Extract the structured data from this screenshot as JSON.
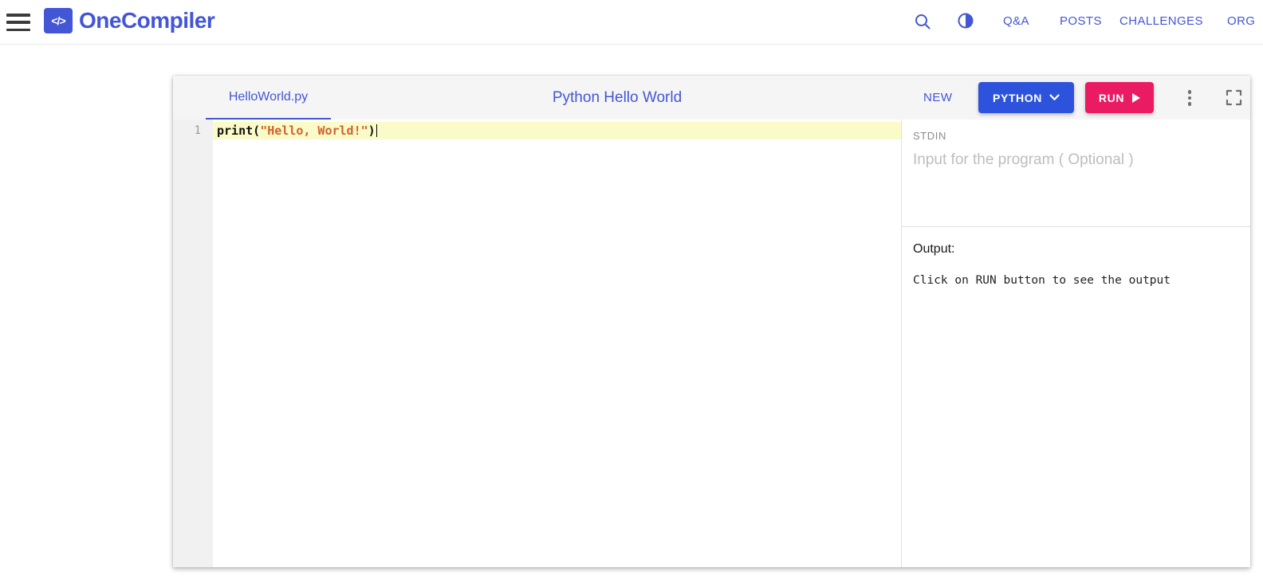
{
  "colors": {
    "brand_blue": "#4356d6",
    "python_button_blue": "#2d53dd",
    "run_button_pink": "#ea1b63",
    "active_line_yellow": "#fbfbc9",
    "code_string_orange": "#d0622b"
  },
  "navbar": {
    "brand": "OneCompiler",
    "brand_icon_glyph": "</>",
    "icons": [
      "search-icon",
      "theme-toggle-icon"
    ],
    "links": [
      {
        "label": "Q&A"
      },
      {
        "label": "POSTS"
      },
      {
        "label": "CHALLENGES"
      },
      {
        "label": "ORG"
      }
    ]
  },
  "editor": {
    "tab_name": "HelloWorld.py",
    "title": "Python Hello World",
    "new_label": "NEW",
    "language_label": "PYTHON",
    "run_label": "RUN",
    "line_number": "1",
    "code": {
      "func": "print(",
      "string": "\"Hello, World!\"",
      "close": ")"
    }
  },
  "stdin": {
    "label": "STDIN",
    "placeholder": "Input for the program ( Optional )"
  },
  "output": {
    "label": "Output:",
    "message": "Click on RUN button to see the output"
  }
}
